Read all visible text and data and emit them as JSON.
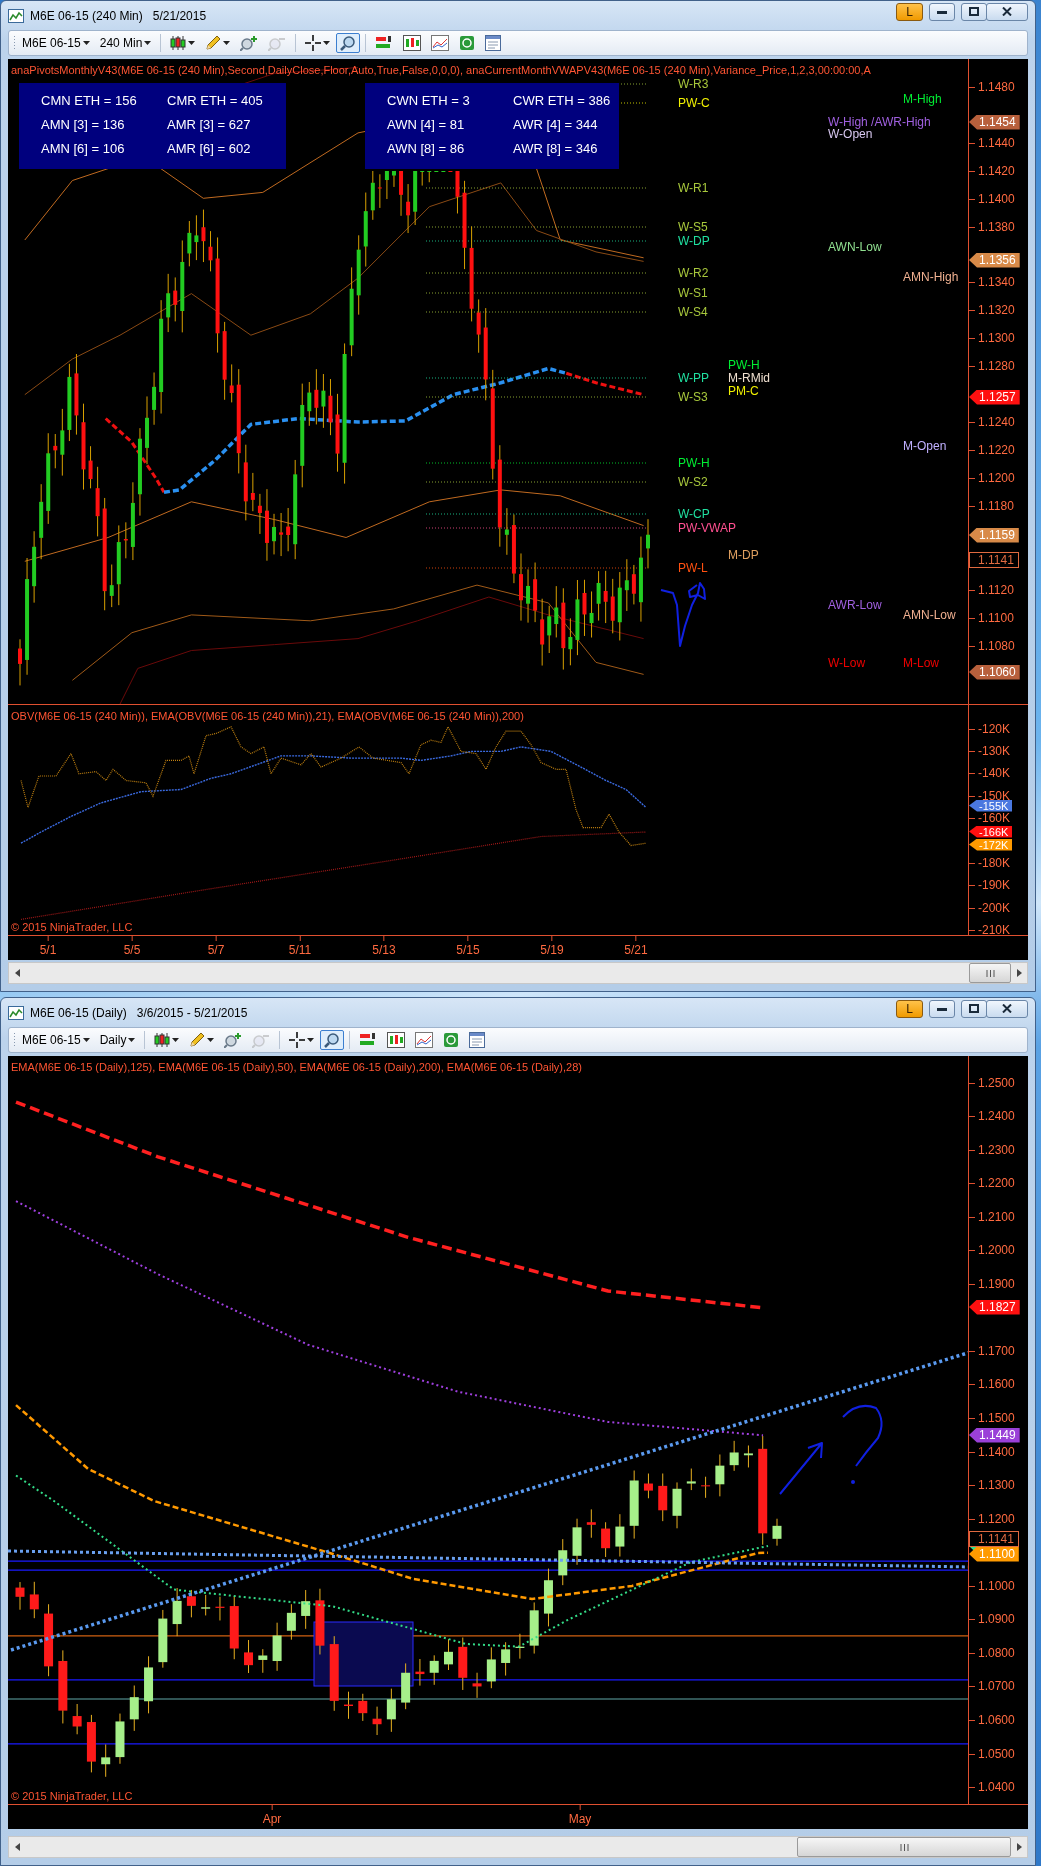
{
  "windows": [
    {
      "kind": "intraday",
      "title": "M6E 06-15 (240 Min)",
      "date_range": "5/21/2015",
      "link_button": "L",
      "toolbar": {
        "instrument": "M6E 06-15",
        "interval": "240 Min",
        "data_box_on": true
      },
      "caption": "anaPivotsMonthlyV43(M6E 06-15 (240 Min),Second,DailyClose,Floor,Auto,True,False,0,0,0), anaCurrentMonthVWAPV43(M6E 06-15 (240 Min),Variance_Price,1,2,3,00:00:00,A",
      "info_panels": [
        {
          "rows": [
            [
              "CMN ETH = 156",
              "CMR ETH = 405"
            ],
            [
              "AMN [3] = 136",
              "AMR [3] = 627"
            ],
            [
              "AMN [6] = 106",
              "AMR [6] = 602"
            ]
          ]
        },
        {
          "rows": [
            [
              "CWN ETH = 3",
              "CWR ETH = 386"
            ],
            [
              "AWN [4] = 81",
              "AWR [4] = 344"
            ],
            [
              "AWN [8] = 86",
              "AWR [8] = 346"
            ]
          ]
        }
      ],
      "level_labels": [
        {
          "text": "W-R3",
          "color": "#a8c83c"
        },
        {
          "text": "PW-C",
          "color": "#f0f000"
        },
        {
          "text": "M-High",
          "color": "#00ee33"
        },
        {
          "text": "W-High /AWR-High",
          "color": "#a060e0"
        },
        {
          "text": "W-Open",
          "color": "#d8c8f0"
        },
        {
          "text": "W-R1",
          "color": "#a8c83c"
        },
        {
          "text": "W-S5",
          "color": "#a8c83c"
        },
        {
          "text": "W-DP",
          "color": "#20e0a0"
        },
        {
          "text": "AWN-Low",
          "color": "#90e090"
        },
        {
          "text": "W-R2",
          "color": "#a8c83c"
        },
        {
          "text": "AMN-High",
          "color": "#f0b090"
        },
        {
          "text": "W-S1",
          "color": "#a8c83c"
        },
        {
          "text": "W-S4",
          "color": "#a8c83c"
        },
        {
          "text": "W-PP",
          "color": "#20e0a0"
        },
        {
          "text": "PW-H",
          "color": "#00ee33"
        },
        {
          "text": "M-RMid",
          "color": "#f0e0d0"
        },
        {
          "text": "PM-C",
          "color": "#f0f000"
        },
        {
          "text": "W-S3",
          "color": "#a8c83c"
        },
        {
          "text": "M-Open",
          "color": "#c0b0ff"
        },
        {
          "text": "PW-H",
          "color": "#00ee33"
        },
        {
          "text": "W-S2",
          "color": "#a8c83c"
        },
        {
          "text": "W-CP",
          "color": "#20e0a0"
        },
        {
          "text": "PW-VWAP",
          "color": "#ff5090"
        },
        {
          "text": "M-DP",
          "color": "#e0a060"
        },
        {
          "text": "PW-L",
          "color": "#ff5010"
        },
        {
          "text": "AWR-Low",
          "color": "#a060e0"
        },
        {
          "text": "AMN-Low",
          "color": "#f0b090"
        },
        {
          "text": "W-Low",
          "color": "#ee0000"
        },
        {
          "text": "M-Low",
          "color": "#ee0000"
        }
      ],
      "price_axis": [
        "1.1480",
        "1.1440",
        "1.1420",
        "1.1400",
        "1.1380",
        "1.1340",
        "1.1320",
        "1.1300",
        "1.1280",
        "1.1240",
        "1.1220",
        "1.1200",
        "1.1180",
        "1.1120",
        "1.1100",
        "1.1080"
      ],
      "price_markers": [
        {
          "text": "1.1454",
          "kind": "filled",
          "color": "#b8603c"
        },
        {
          "text": "1.1356",
          "kind": "filled",
          "color": "#d88a48"
        },
        {
          "text": "1.1257",
          "kind": "filled",
          "color": "#ff1010"
        },
        {
          "text": "1.1159",
          "kind": "filled",
          "color": "#d88a48"
        },
        {
          "text": "1.1141",
          "kind": "outline",
          "color": "#e06a40"
        },
        {
          "text": "1.1060",
          "kind": "filled",
          "color": "#b8603c"
        }
      ],
      "subpanel": {
        "caption": "OBV(M6E 06-15 (240 Min)), EMA(OBV(M6E 06-15 (240 Min)),21), EMA(OBV(M6E 06-15 (240 Min)),200)",
        "axis": [
          "-120K",
          "-130K",
          "-140K",
          "-150K",
          "-160K",
          "-180K",
          "-190K",
          "-200K",
          "-210K"
        ],
        "markers": [
          {
            "text": "-155K",
            "kind": "filled",
            "color": "#4a78e0"
          },
          {
            "text": "-166K",
            "kind": "filled",
            "color": "#ff1010"
          },
          {
            "text": "-172K",
            "kind": "filled",
            "color": "#ff9a00"
          }
        ],
        "copyright": "© 2015 NinjaTrader, LLC"
      },
      "date_axis": [
        "5/1",
        "5/5",
        "5/7",
        "5/11",
        "5/13",
        "5/15",
        "5/19",
        "5/21"
      ]
    },
    {
      "kind": "daily",
      "title": "M6E 06-15 (Daily)",
      "date_range": "3/6/2015 - 5/21/2015",
      "link_button": "L",
      "toolbar": {
        "instrument": "M6E 06-15",
        "interval": "Daily",
        "data_box_on": true
      },
      "caption": "EMA(M6E 06-15 (Daily),125), EMA(M6E 06-15 (Daily),50), EMA(M6E 06-15 (Daily),200), EMA(M6E 06-15 (Daily),28)",
      "copyright": "© 2015 NinjaTrader, LLC",
      "price_axis": [
        "1.2500",
        "1.2400",
        "1.2300",
        "1.2200",
        "1.2100",
        "1.2000",
        "1.1900",
        "1.1700",
        "1.1600",
        "1.1500",
        "1.1400",
        "1.1300",
        "1.1200",
        "1.1000",
        "1.0900",
        "1.0800",
        "1.0700",
        "1.0600",
        "1.0500",
        "1.0400"
      ],
      "price_markers": [
        {
          "text": "1.1827",
          "kind": "filled",
          "color": "#ff1010"
        },
        {
          "text": "1.1449",
          "kind": "filled",
          "color": "#9a40d8"
        },
        {
          "text": "1.1141",
          "kind": "outline",
          "color": "#e06a40"
        },
        {
          "kind": "covered",
          "color": "#30e090"
        },
        {
          "text": "1.1100",
          "kind": "filled",
          "color": "#ff9a00"
        }
      ],
      "date_axis": [
        "Apr",
        "May"
      ]
    }
  ]
}
